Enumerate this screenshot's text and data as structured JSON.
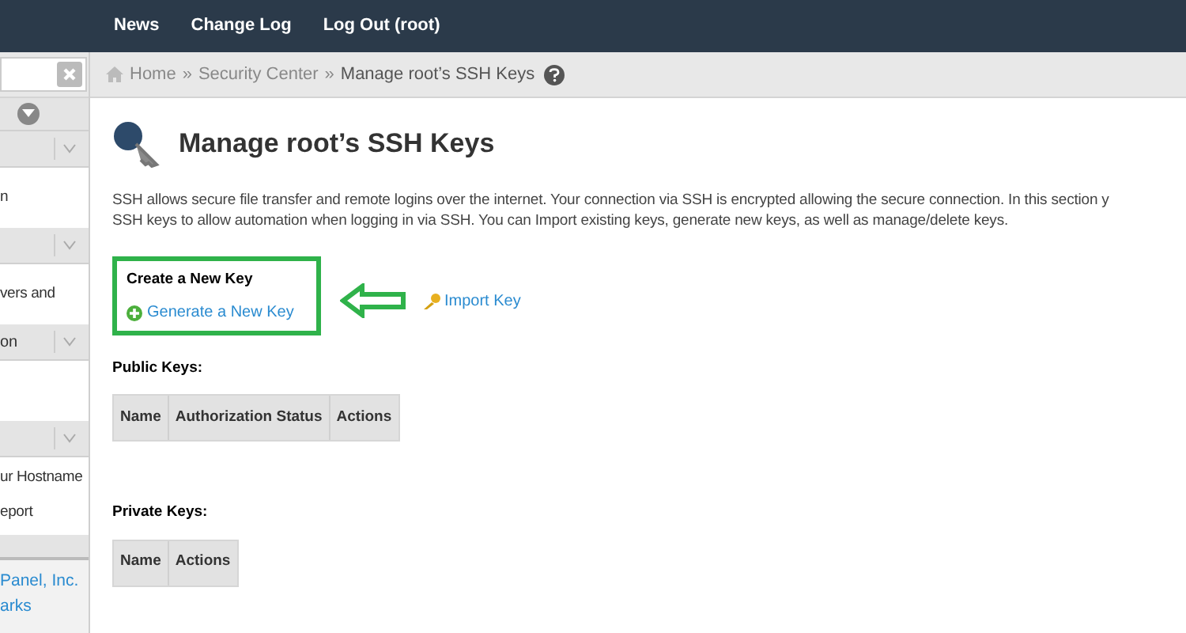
{
  "top_nav": {
    "items": [
      "News",
      "Change Log",
      "Log Out (root)"
    ]
  },
  "sidebar": {
    "sections": [
      {
        "items": [
          "n"
        ]
      },
      {
        "items": [
          "vers and"
        ]
      },
      {
        "label": "on"
      },
      {
        "items": [
          "ur Hostname",
          "eport"
        ]
      }
    ],
    "footer": [
      "Panel, Inc.",
      "arks"
    ]
  },
  "breadcrumb": {
    "items": [
      "Home",
      "Security Center",
      "Manage root’s SSH Keys"
    ],
    "separator": "»"
  },
  "page": {
    "title": "Manage root’s SSH Keys",
    "description": [
      "SSH allows secure file transfer and remote logins over the internet. Your connection via SSH is encrypted allowing the secure connection. In this section y",
      "SSH keys to allow automation when logging in via SSH. You can Import existing keys, generate new keys, as well as manage/delete keys."
    ],
    "create_heading": "Create a New Key",
    "generate_link": "Generate a New Key",
    "import_link": "Import Key",
    "public_keys": {
      "heading": "Public Keys:",
      "columns": [
        "Name",
        "Authorization Status",
        "Actions"
      ]
    },
    "private_keys": {
      "heading": "Private Keys:",
      "columns": [
        "Name",
        "Actions"
      ]
    }
  }
}
